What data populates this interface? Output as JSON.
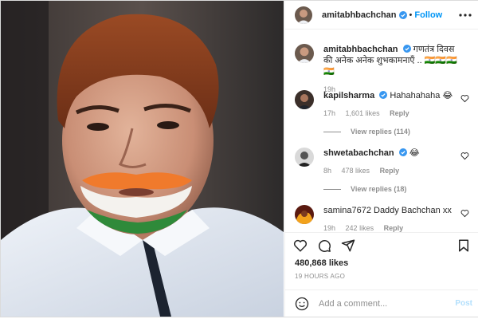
{
  "post": {
    "author": "amitabhbachchan",
    "follow_label": "Follow",
    "separator": "•",
    "caption": "गणतंत्र दिवस की अनेक अनेक शुभकामनाएँ .. 🇮🇳🇮🇳🇮🇳🇮🇳",
    "caption_time": "19h",
    "likes": "480,868 likes",
    "time_ago": "19 HOURS AGO"
  },
  "comments": [
    {
      "user": "kapilsharma",
      "verified": true,
      "text": "Hahahahaha 😂",
      "time": "17h",
      "likes": "1,601 likes",
      "reply": "Reply",
      "view_replies": "View replies (114)"
    },
    {
      "user": "shwetabachchan",
      "verified": true,
      "text": "😂",
      "time": "8h",
      "likes": "478 likes",
      "reply": "Reply",
      "view_replies": "View replies (18)"
    },
    {
      "user": "samina7672",
      "verified": false,
      "text": "Daddy Bachchan xx",
      "time": "19h",
      "likes": "242 likes",
      "reply": "Reply"
    }
  ],
  "add_comment": {
    "placeholder": "Add a comment...",
    "post_label": "Post"
  },
  "colors": {
    "accent": "#0095f6",
    "post_disabled": "#b2dffc",
    "verified": "#3897f0",
    "muted": "#8e8e8e"
  },
  "icons": [
    "more-options-icon",
    "verified-icon",
    "heart-icon",
    "comment-icon",
    "share-icon",
    "bookmark-icon",
    "emoji-icon"
  ]
}
